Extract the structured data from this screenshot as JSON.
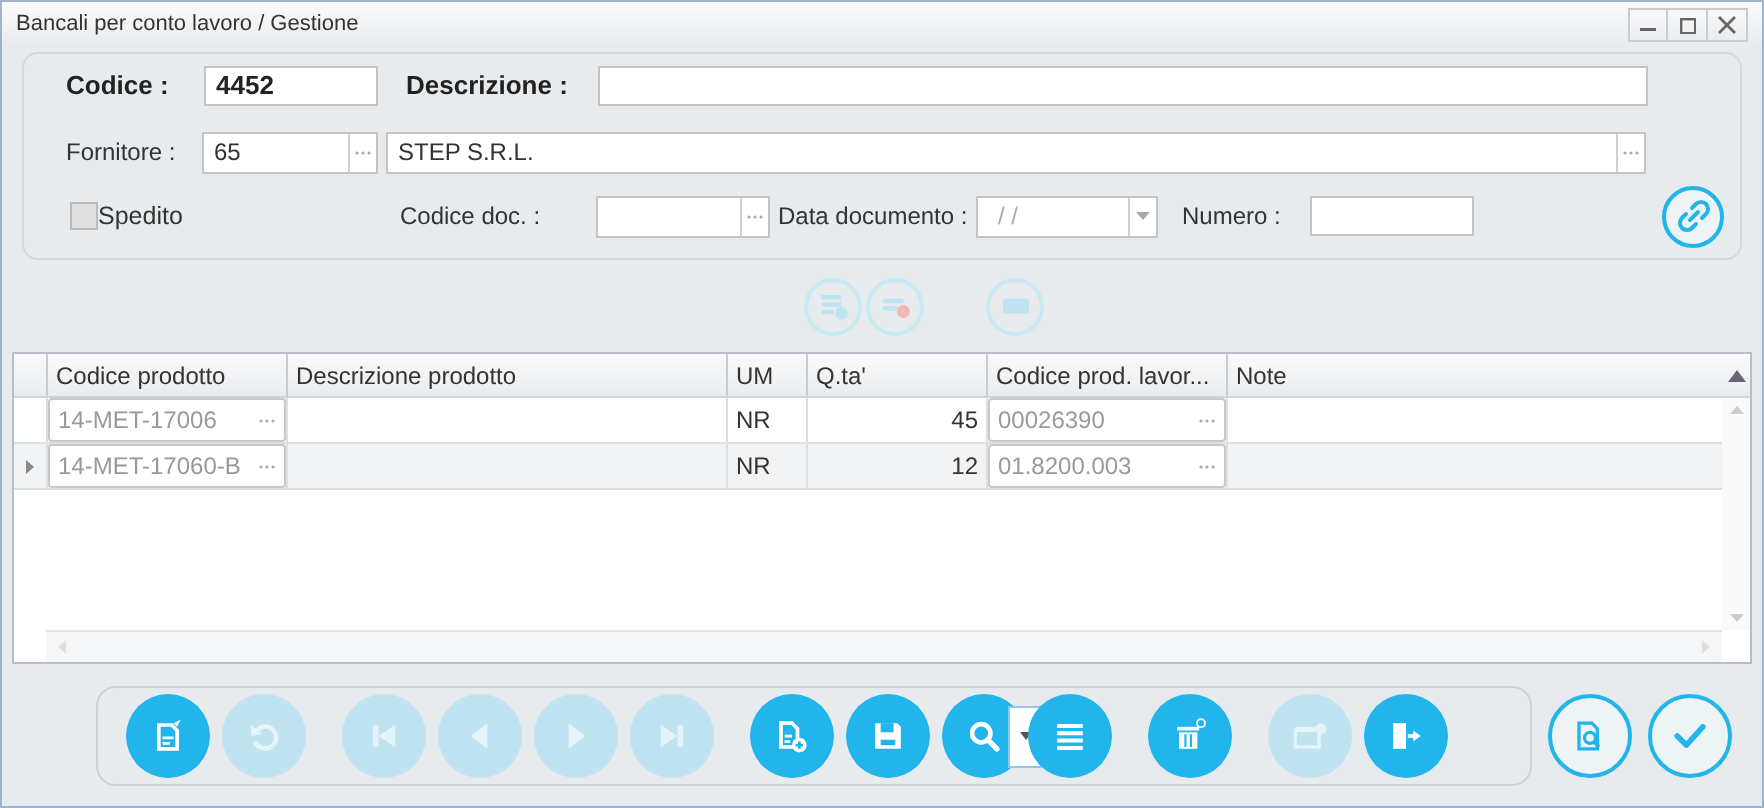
{
  "window": {
    "title": "Bancali per conto lavoro / Gestione"
  },
  "form": {
    "codice": {
      "label": "Codice :",
      "value": "4452"
    },
    "descrizione": {
      "label": "Descrizione :"
    },
    "fornitore": {
      "label": "Fornitore :",
      "code": "65",
      "name": "STEP S.R.L."
    },
    "spedito": {
      "label": "Spedito",
      "checked": false
    },
    "codice_doc": {
      "label": "Codice doc. :"
    },
    "data_documento": {
      "label": "Data documento :",
      "value": "/ /"
    },
    "numero": {
      "label": "Numero :"
    }
  },
  "detail_buttons": [
    {
      "kind": "add-row",
      "enabled": false
    },
    {
      "kind": "remove-row",
      "enabled": false
    },
    {
      "kind": "barcode",
      "enabled": false
    }
  ],
  "table": {
    "columns": [
      "Codice prodotto",
      "Descrizione prodotto",
      "UM",
      "Q.ta'",
      "Codice prod. lavor...",
      "Note"
    ],
    "rows": [
      {
        "codice_prodotto": "14-MET-17006",
        "um": "NR",
        "qta": "45",
        "codice_prod_lavor": "00026390",
        "current": false
      },
      {
        "codice_prodotto": "14-MET-17060-B",
        "um": "NR",
        "qta": "12",
        "codice_prod_lavor": "01.8200.003",
        "current": true
      }
    ]
  },
  "toolbar": [
    {
      "kind": "edit",
      "enabled": true
    },
    {
      "kind": "undo",
      "enabled": false
    },
    {
      "kind": "first",
      "enabled": false
    },
    {
      "kind": "previous",
      "enabled": false
    },
    {
      "kind": "next",
      "enabled": false
    },
    {
      "kind": "last",
      "enabled": false
    },
    {
      "kind": "new",
      "enabled": true
    },
    {
      "kind": "save",
      "enabled": true
    },
    {
      "kind": "search",
      "enabled": true
    },
    {
      "kind": "dropdown",
      "enabled": true
    },
    {
      "kind": "list",
      "enabled": true
    },
    {
      "kind": "delete",
      "enabled": true
    },
    {
      "kind": "clapper",
      "enabled": false
    },
    {
      "kind": "exit",
      "enabled": true
    }
  ],
  "side_buttons": [
    {
      "kind": "preview",
      "enabled": true
    },
    {
      "kind": "confirm",
      "enabled": true
    }
  ]
}
